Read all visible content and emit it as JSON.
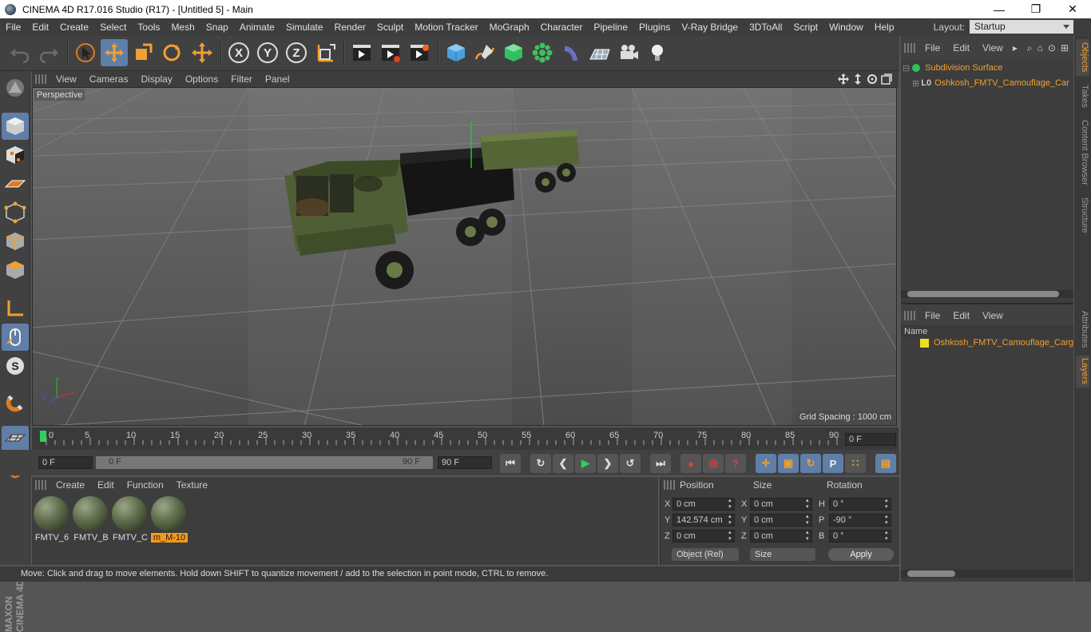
{
  "window": {
    "title": "CINEMA 4D R17.016 Studio (R17) - [Untitled 5] - Main",
    "minimize": "—",
    "restore": "❐",
    "close": "✕"
  },
  "menu": [
    "File",
    "Edit",
    "Create",
    "Select",
    "Tools",
    "Mesh",
    "Snap",
    "Animate",
    "Simulate",
    "Render",
    "Sculpt",
    "Motion Tracker",
    "MoGraph",
    "Character",
    "Pipeline",
    "Plugins",
    "V-Ray Bridge",
    "3DToAll",
    "Script",
    "Window",
    "Help"
  ],
  "layout": {
    "label": "Layout:",
    "value": "Startup"
  },
  "viewport": {
    "menu": [
      "View",
      "Cameras",
      "Display",
      "Options",
      "Filter",
      "Panel"
    ],
    "label": "Perspective",
    "grid_spacing": "Grid Spacing : 1000 cm"
  },
  "timeline": {
    "ticks": [
      "0",
      "5",
      "10",
      "15",
      "20",
      "25",
      "30",
      "35",
      "40",
      "45",
      "50",
      "55",
      "60",
      "65",
      "70",
      "75",
      "80",
      "85",
      "90"
    ],
    "current_frame": "0 F",
    "start": "0 F",
    "range_start": "0 F",
    "range_end": "90 F",
    "end": "90 F"
  },
  "materials": {
    "menu": [
      "Create",
      "Edit",
      "Function",
      "Texture"
    ],
    "items": [
      {
        "name": "FMTV_6",
        "selected": false
      },
      {
        "name": "FMTV_B",
        "selected": false
      },
      {
        "name": "FMTV_C",
        "selected": false
      },
      {
        "name": "m_M-10",
        "selected": true
      }
    ]
  },
  "coords": {
    "headers": {
      "position": "Position",
      "size": "Size",
      "rotation": "Rotation"
    },
    "rows": [
      {
        "pa": "X",
        "pv": "0 cm",
        "sa": "X",
        "sv": "0 cm",
        "ra": "H",
        "rv": "0 °"
      },
      {
        "pa": "Y",
        "pv": "142.574 cm",
        "sa": "Y",
        "sv": "0 cm",
        "ra": "P",
        "rv": "-90 °"
      },
      {
        "pa": "Z",
        "pv": "0 cm",
        "sa": "Z",
        "sv": "0 cm",
        "ra": "B",
        "rv": "0 °"
      }
    ],
    "mode": "Object (Rel)",
    "size_mode": "Size",
    "apply": "Apply"
  },
  "objects_panel": {
    "menu": [
      "File",
      "Edit",
      "View"
    ],
    "items": [
      "Subdivision Surface",
      "Oshkosh_FMTV_Camouflage_Car"
    ]
  },
  "layers_panel": {
    "menu": [
      "File",
      "Edit",
      "View"
    ],
    "column": "Name",
    "items": [
      "Oshkosh_FMTV_Camouflage_Carg"
    ]
  },
  "side_tabs": [
    "Objects",
    "Takes",
    "Content Browser",
    "Structure",
    "Attributes",
    "Layers"
  ],
  "brand": "MAXON CINEMA 4D",
  "status": "Move: Click and drag to move elements. Hold down SHIFT to quantize movement / add to the selection in point mode, CTRL to remove.",
  "colors": {
    "accent": "#5f7fa8",
    "highlight": "#f29b1a",
    "object_text": "#f0a030"
  }
}
